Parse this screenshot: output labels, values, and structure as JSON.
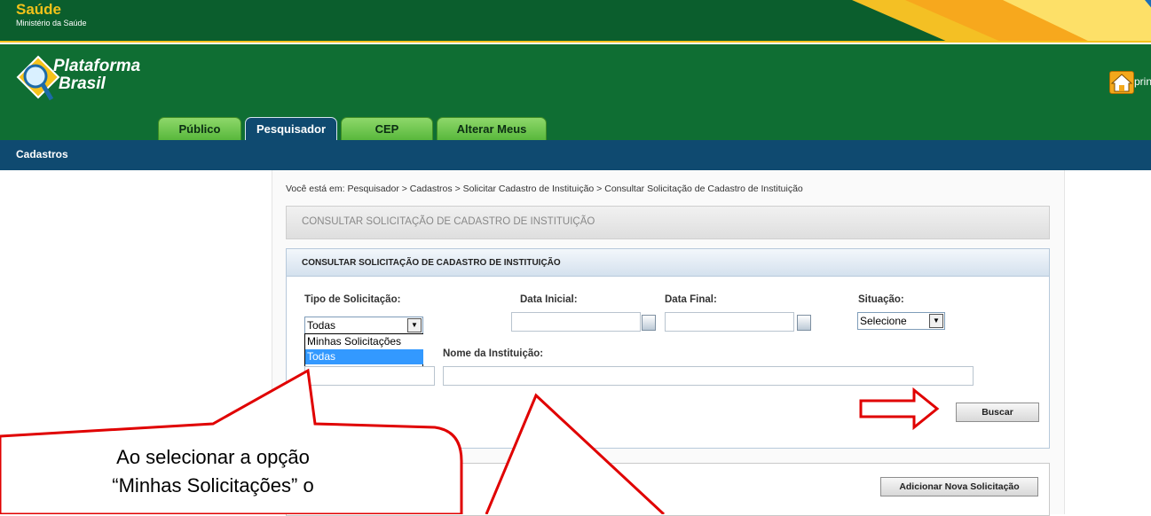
{
  "gov": {
    "title": "Saúde",
    "subtitle": "Ministério da Saúde"
  },
  "logo": {
    "line1": "Plataforma",
    "line2": "Brasil"
  },
  "home": {
    "icon": "home-icon",
    "label": "principa"
  },
  "tabs": [
    {
      "label": "Público"
    },
    {
      "label": "Pesquisador"
    },
    {
      "label": "CEP"
    },
    {
      "label": "Alterar Meus Dados"
    }
  ],
  "nav": {
    "menu": "Cadastros"
  },
  "breadcrumb": "Você está em: Pesquisador > Cadastros > Solicitar Cadastro de Instituição > Consultar Solicitação de Cadastro de Instituição",
  "page_title": "CONSULTAR SOLICITAÇÃO DE CADASTRO DE INSTITUIÇÃO",
  "panel": {
    "title": "CONSULTAR SOLICITAÇÃO DE CADASTRO DE INSTITUIÇÃO",
    "tipo_label": "Tipo de Solicitação:",
    "tipo_value": "Todas",
    "tipo_options": [
      "Minhas Solicitações",
      "Todas"
    ],
    "data_inicial_label": "Data Inicial:",
    "data_final_label": "Data Final:",
    "situacao_label": "Situação:",
    "situacao_value": "Selecione",
    "nome_label": "Nome da Instituição:",
    "buscar_label": "Buscar"
  },
  "panel2": {
    "add_label": "Adicionar Nova Solicitação"
  },
  "annotation": {
    "line1": "Ao selecionar a opção",
    "line2": "“Minhas Solicitações” o",
    "color": "#e00000"
  }
}
